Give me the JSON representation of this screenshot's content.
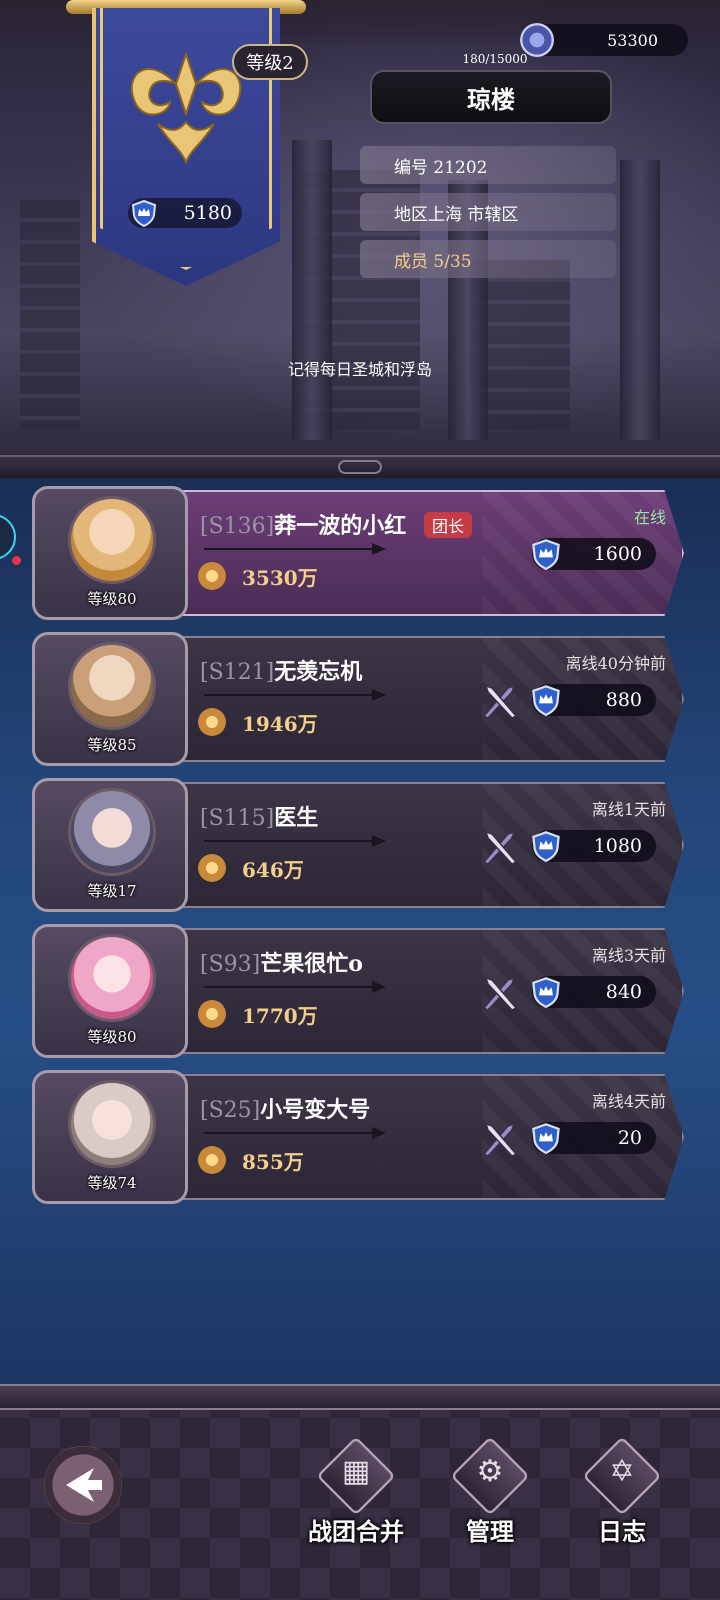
{
  "header": {
    "banner_score": "5180",
    "level_label": "等级2",
    "exp_text": "180/15000",
    "currency_value": "53300",
    "guild_name": "琼楼",
    "id_text": "编号 21202",
    "region_text": "地区上海 市辖区",
    "members_text": "成员 5/35",
    "notice": "记得每日圣城和浮岛"
  },
  "members": [
    {
      "server": "[S136]",
      "name": "莽一波的小红",
      "badge": "团长",
      "level": "等级80",
      "power": "3530万",
      "status": "在线",
      "score": "1600",
      "avatar_color": "#e7c59a"
    },
    {
      "server": "[S121]",
      "name": "无羡忘机",
      "badge": "",
      "level": "等级85",
      "power": "1946万",
      "status": "离线40分钟前",
      "score": "880",
      "avatar_color": "#c9a07a"
    },
    {
      "server": "[S115]",
      "name": "医生",
      "badge": "",
      "level": "等级17",
      "power": "646万",
      "status": "离线1天前",
      "score": "1080",
      "avatar_color": "#8f8aa8"
    },
    {
      "server": "[S93]",
      "name": "芒果很忙o",
      "badge": "",
      "level": "等级80",
      "power": "1770万",
      "status": "离线3天前",
      "score": "840",
      "avatar_color": "#f0a6c6"
    },
    {
      "server": "[S25]",
      "name": "小号变大号",
      "badge": "",
      "level": "等级74",
      "power": "855万",
      "status": "离线4天前",
      "score": "20",
      "avatar_color": "#d9ccc6"
    }
  ],
  "bottom_nav": {
    "merge_label": "战团合并",
    "manage_label": "管理",
    "log_label": "日志"
  },
  "colors": {
    "accent_gold": "#f3cf8a",
    "leader_card": "#6d3e78",
    "online_green": "#9be3a6",
    "leader_badge": "#c53b46"
  }
}
